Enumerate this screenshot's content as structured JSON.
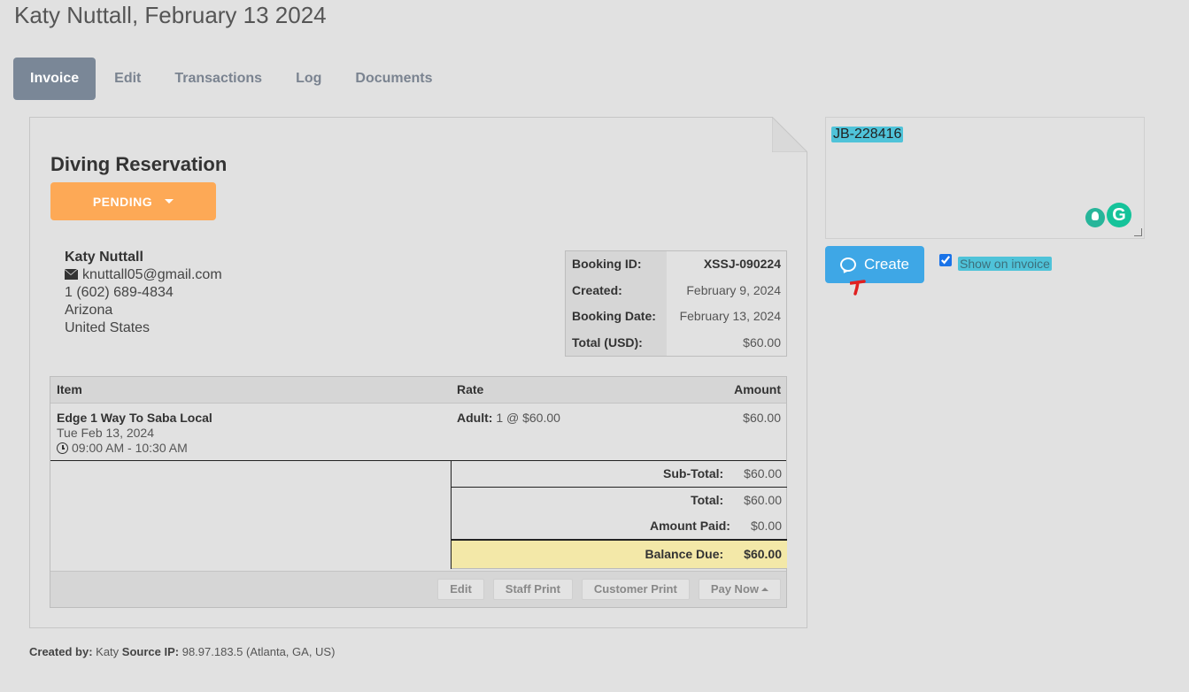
{
  "page": {
    "title": "Katy Nuttall, February 13 2024"
  },
  "tabs": [
    {
      "label": "Invoice",
      "active": true
    },
    {
      "label": "Edit"
    },
    {
      "label": "Transactions"
    },
    {
      "label": "Log"
    },
    {
      "label": "Documents"
    }
  ],
  "invoice": {
    "title": "Diving Reservation",
    "status": "PENDING",
    "customer": {
      "name": "Katy Nuttall",
      "email": "knuttall05@gmail.com",
      "phone": "1 (602) 689-4834",
      "state": "Arizona",
      "country": "United States"
    },
    "booking": {
      "id_label": "Booking ID:",
      "id": "XSSJ-090224",
      "created_label": "Created:",
      "created": "February 9, 2024",
      "date_label": "Booking Date:",
      "date": "February 13, 2024",
      "total_label": "Total (USD):",
      "total": "$60.00"
    },
    "table": {
      "headers": {
        "item": "Item",
        "rate": "Rate",
        "amount": "Amount"
      },
      "rows": [
        {
          "item": "Edge 1 Way To Saba Local",
          "date": "Tue Feb 13, 2024",
          "time": "09:00 AM - 10:30 AM",
          "rate_label": "Adult:",
          "rate": "1 @ $60.00",
          "amount": "$60.00"
        }
      ]
    },
    "totals": {
      "subtotal_label": "Sub-Total:",
      "subtotal": "$60.00",
      "total_label": "Total:",
      "total": "$60.00",
      "paid_label": "Amount Paid:",
      "paid": "$0.00",
      "balance_label": "Balance Due:",
      "balance": "$60.00"
    },
    "actions": {
      "edit": "Edit",
      "staff_print": "Staff Print",
      "customer_print": "Customer Print",
      "pay_now": "Pay Now"
    }
  },
  "footer": {
    "created_by_label": "Created by:",
    "created_by": "Katy",
    "source_ip_label": "Source IP:",
    "source_ip": "98.97.183.5 (Atlanta, GA, US)"
  },
  "note": {
    "text": "JB-228416",
    "create_label": "Create",
    "show_on_invoice_label": "Show on invoice",
    "show_on_invoice_checked": true,
    "grammarly_letter": "G"
  },
  "colors": {
    "status": "#fda956",
    "create": "#3ea7e6",
    "balance_bg": "#f3e8a8",
    "highlight": "#4fc3d9",
    "active_tab": "#7a8797"
  }
}
